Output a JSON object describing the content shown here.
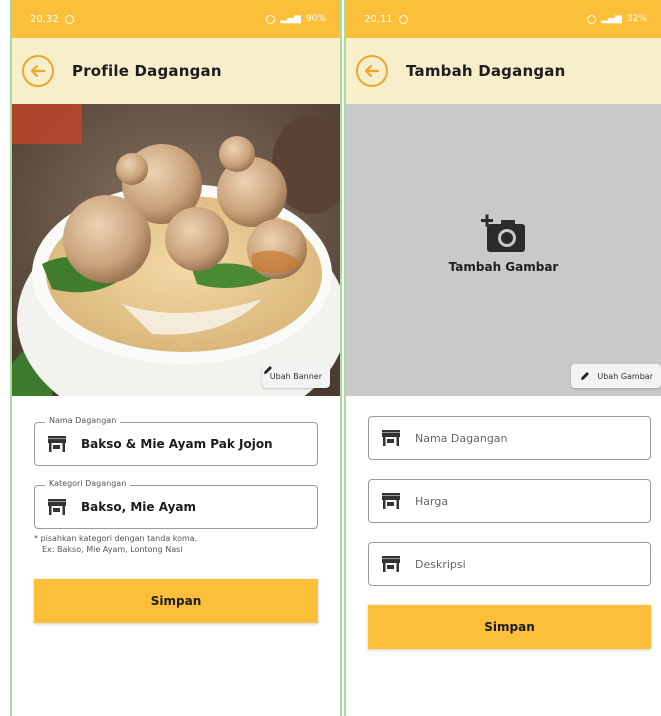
{
  "screen1": {
    "status": {
      "time": "20.32",
      "battery": "90%"
    },
    "title": "Profile Dagangan",
    "banner_button": "Ubah Banner",
    "fields": [
      {
        "legend": "Nama Dagangan",
        "value": "Bakso & Mie Ayam Pak Jojon",
        "icon": "store-icon"
      },
      {
        "legend": "Kategori Dagangan",
        "value": "Bakso, Mie Ayam",
        "icon": "store-icon"
      }
    ],
    "hint_line1": "* pisahkan kategori dengan tanda koma.",
    "hint_line2": "Ex: Bakso, Mie Ayam, Lontong Nasi",
    "save_label": "Simpan"
  },
  "screen2": {
    "status": {
      "time": "20.11",
      "battery": "32%"
    },
    "title": "Tambah Dagangan",
    "add_image_label": "Tambah Gambar",
    "image_button": "Ubah Gambar",
    "fields": [
      {
        "placeholder": "Nama Dagangan",
        "icon": "store-icon"
      },
      {
        "placeholder": "Harga",
        "icon": "store-icon"
      },
      {
        "placeholder": "Deskripsi",
        "icon": "store-icon"
      }
    ],
    "save_label": "Simpan"
  },
  "colors": {
    "accent": "#fbbf3a",
    "appbar": "#f7efcb",
    "back": "#f0a52a",
    "placeholder_bg": "#c7c9ca"
  }
}
